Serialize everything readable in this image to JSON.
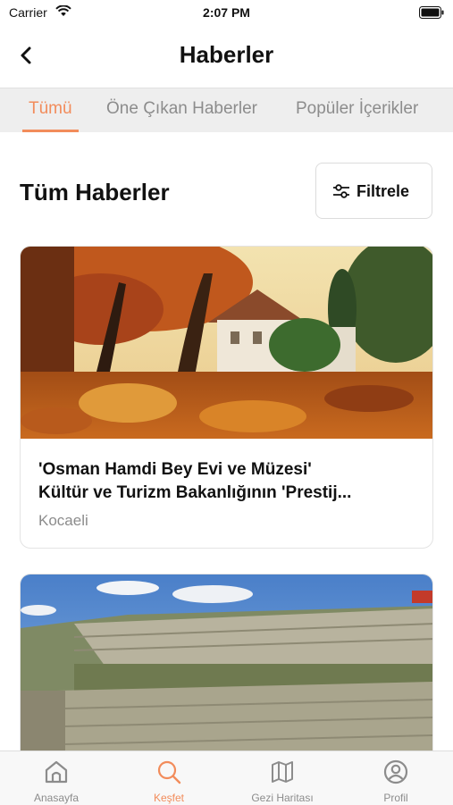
{
  "status_bar": {
    "carrier": "Carrier",
    "time": "2:07 PM"
  },
  "header": {
    "title": "Haberler"
  },
  "tabs": [
    {
      "label": "Tümü",
      "active": true
    },
    {
      "label": "Öne Çıkan Haberler",
      "active": false
    },
    {
      "label": "Popüler İçerikler",
      "active": false
    }
  ],
  "section": {
    "title": "Tüm Haberler",
    "filter_label": "Filtrele"
  },
  "news": [
    {
      "title_line1": "'Osman Hamdi Bey Evi ve Müzesi'",
      "title_line2": "Kültür ve Turizm Bakanlığının 'Prestij...",
      "location": "Kocaeli"
    }
  ],
  "bottom_nav": [
    {
      "label": "Anasayfa",
      "icon": "home-icon"
    },
    {
      "label": "Keşfet",
      "icon": "search-icon",
      "active": true
    },
    {
      "label": "Gezi Haritası",
      "icon": "map-icon"
    },
    {
      "label": "Profil",
      "icon": "profile-icon"
    }
  ],
  "colors": {
    "accent": "#f28c5b",
    "inactive": "#8c8c8c"
  }
}
